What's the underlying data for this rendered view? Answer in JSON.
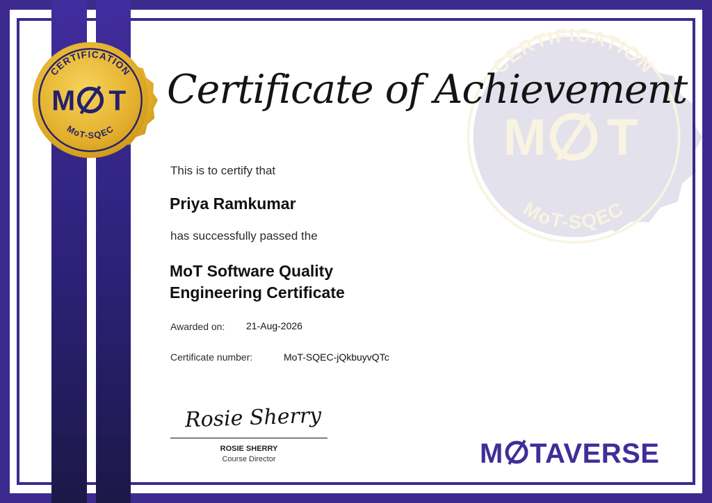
{
  "seal": {
    "arc_top": "CERTIFICATION",
    "mark_left": "M",
    "mark_right": "T",
    "arc_bottom": "MoT-SQEC"
  },
  "certificate": {
    "title": "Certificate of Achievement",
    "intro": "This is to certify that",
    "recipient": "Priya Ramkumar",
    "passed_text": "has successfully passed the",
    "cert_line1": "MoT Software Quality",
    "cert_line2": "Engineering Certificate",
    "awarded_label": "Awarded on:",
    "awarded_date": "21-Aug-2026",
    "number_label": "Certificate number:",
    "number_value": "MoT-SQEC-jQkbuyvQTc"
  },
  "signatory": {
    "signature": "Rosie Sherry",
    "name": "ROSIE SHERRY",
    "title": "Course Director"
  },
  "logo": {
    "left": "M",
    "right": "TAVERSE"
  },
  "colors": {
    "frame": "#3c2a8e",
    "ribbon_top": "#412d9e",
    "ribbon_bottom": "#1c1847",
    "gold": "#e6b630",
    "gold_dark": "#c99516",
    "navy": "#25206b",
    "logo": "#3f2e99"
  }
}
